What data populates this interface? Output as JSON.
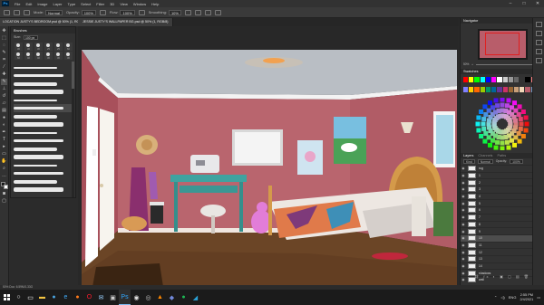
{
  "app": {
    "logo_text": "Ps",
    "menu": [
      "File",
      "Edit",
      "Image",
      "Layer",
      "Type",
      "Select",
      "Filter",
      "3D",
      "View",
      "Window",
      "Help"
    ]
  },
  "options_bar": {
    "mode_label": "Mode:",
    "mode_value": "Normal",
    "opacity_label": "Opacity:",
    "opacity_value": "100%",
    "flow_label": "Flow:",
    "flow_value": "100%",
    "smoothing_label": "Smoothing:",
    "smoothing_value": "10%"
  },
  "documents": {
    "active_tab": "LOCATION JUSTY'S BEDROOM.psd @ 50% (1, RGB/8)",
    "second_tab": "JESSIE JUSTY'S WALLPAPER BG.psd @ 50% (1, RGB/8)"
  },
  "brushes_panel": {
    "title": "Brushes",
    "size_label": "Size:",
    "size_value": "100 px",
    "preset_sizes": [
      "30",
      "30",
      "30",
      "25",
      "25",
      "60",
      "60",
      "40",
      "40",
      "30",
      "30",
      "30"
    ],
    "selected_stroke_index": 5,
    "stroke_count": 16
  },
  "navigator": {
    "title": "Navigator",
    "zoom": "50%"
  },
  "swatches": {
    "title": "Swatches",
    "colors": [
      "#ff0000",
      "#ffff00",
      "#00ff00",
      "#00ffff",
      "#0000ff",
      "#ff00ff",
      "#ffffff",
      "#cccccc",
      "#999999",
      "#666666",
      "#333333",
      "#000000",
      "#ff8080",
      "#80ff80",
      "#8080ff",
      "#ffcc00",
      "#ff6600",
      "#99cc00",
      "#009966",
      "#006699",
      "#663399",
      "#cc3366",
      "#996633",
      "#c8a07a",
      "#f0d8b8",
      "#b85d6a",
      "#7a9cc6",
      "#4f7a3a"
    ]
  },
  "layers": {
    "title": "Layers",
    "tab2": "Channels",
    "tab3": "Paths",
    "kind_label": "Kind",
    "blend_value": "Normal",
    "opacity_label": "Opacity:",
    "opacity_value": "100%",
    "fill_label": "Fill:",
    "fill_value": "100%",
    "items": [
      {
        "name": "rug"
      },
      {
        "name": "1"
      },
      {
        "name": "2"
      },
      {
        "name": "3"
      },
      {
        "name": "4"
      },
      {
        "name": "5"
      },
      {
        "name": "6"
      },
      {
        "name": "7"
      },
      {
        "name": "8"
      },
      {
        "name": "9"
      },
      {
        "name": "10"
      },
      {
        "name": "11"
      },
      {
        "name": "12"
      },
      {
        "name": "13"
      },
      {
        "name": "14"
      },
      {
        "name": "shadows"
      },
      {
        "name": "wall"
      }
    ],
    "selected_index": 10
  },
  "status": {
    "text": "50%      Doc: 6.59M/1.33G"
  },
  "taskbar": {
    "icons": [
      {
        "name": "search",
        "glyph": "○",
        "color": "#ffffff"
      },
      {
        "name": "task-view",
        "glyph": "▭",
        "color": "#ffffff"
      },
      {
        "name": "file-explorer",
        "glyph": "▬",
        "color": "#f4c542"
      },
      {
        "name": "chrome",
        "glyph": "●",
        "color": "#4aa3df"
      },
      {
        "name": "edge",
        "glyph": "e",
        "color": "#3fa9f5"
      },
      {
        "name": "firefox",
        "glyph": "●",
        "color": "#ff7a1a"
      },
      {
        "name": "opera",
        "glyph": "O",
        "color": "#ff1b2d"
      },
      {
        "name": "mail",
        "glyph": "✉",
        "color": "#9ad0ff"
      },
      {
        "name": "store",
        "glyph": "▣",
        "color": "#cfcfcf"
      },
      {
        "name": "photoshop",
        "glyph": "Ps",
        "color": "#31a8ff"
      },
      {
        "name": "obs",
        "glyph": "◉",
        "color": "#e0e0e0"
      },
      {
        "name": "steam",
        "glyph": "◎",
        "color": "#c0c0c0"
      },
      {
        "name": "vlc",
        "glyph": "▲",
        "color": "#ff8800"
      },
      {
        "name": "discord",
        "glyph": "◆",
        "color": "#7289da"
      },
      {
        "name": "spotify",
        "glyph": "●",
        "color": "#1db954"
      },
      {
        "name": "telegram",
        "glyph": "◢",
        "color": "#2aa3d8"
      }
    ],
    "active_icon": "photoshop",
    "language": "ENG",
    "time": "2:55 PM",
    "date": "2/4/2021"
  }
}
